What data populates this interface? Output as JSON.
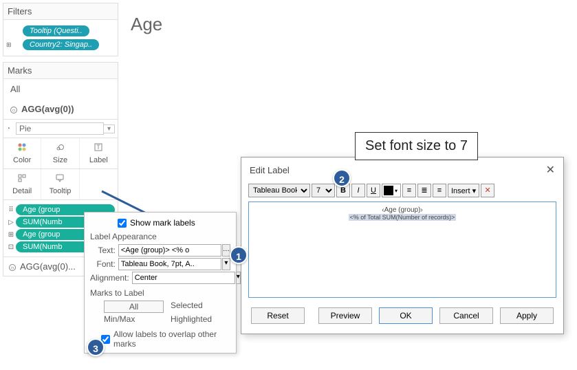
{
  "sidebar": {
    "filters_header": "Filters",
    "filter_pills": [
      {
        "label": "Tooltip (Questi..",
        "has_close": true
      },
      {
        "label": "Country2: Singap..",
        "has_close": false,
        "indicator": "⊞"
      }
    ],
    "marks_header": "Marks",
    "marks_tabs": [
      {
        "label": "All",
        "selected": false
      },
      {
        "label": "AGG(avg(0))",
        "selected": true,
        "icon": "○"
      }
    ],
    "mark_type": "Pie",
    "shelves_top": [
      {
        "label": "Color",
        "icon": "color"
      },
      {
        "label": "Size",
        "icon": "size"
      },
      {
        "label": "Label",
        "icon": "label"
      }
    ],
    "shelves_bottom": [
      {
        "label": "Detail",
        "icon": "detail"
      },
      {
        "label": "Tooltip",
        "icon": "tooltip"
      },
      {
        "label": "",
        "icon": ""
      }
    ],
    "mark_pills": [
      {
        "icon": "⠿",
        "label": "Age (group"
      },
      {
        "icon": "▷",
        "label": "SUM(Numb"
      },
      {
        "icon": "⊞",
        "label": "Age (group"
      },
      {
        "icon": "⊡",
        "label": "SUM(Numb"
      }
    ],
    "agg_row": "AGG(avg(0)..."
  },
  "canvas": {
    "title": "Age"
  },
  "label_popup": {
    "show_mark_labels": "Show mark labels",
    "show_mark_labels_checked": true,
    "appearance_header": "Label Appearance",
    "text_label": "Text:",
    "text_value": "<Age (group)> <% o",
    "font_label": "Font:",
    "font_value": "Tableau Book, 7pt, A..",
    "alignment_label": "Alignment:",
    "alignment_value": "Center",
    "marks_to_label_header": "Marks to Label",
    "mtl_options": [
      "All",
      "Selected",
      "Min/Max",
      "Highlighted"
    ],
    "overlap_label": "Allow labels to overlap other marks",
    "overlap_checked": true
  },
  "dialog": {
    "title": "Edit Label",
    "font_name": "Tableau Book",
    "font_size": "7",
    "insert_label": "Insert ▾",
    "editor_line1": "‹Age (group)›",
    "editor_line2": "<% of Total SUM(Number of records)>",
    "buttons": {
      "reset": "Reset",
      "preview": "Preview",
      "ok": "OK",
      "cancel": "Cancel",
      "apply": "Apply"
    }
  },
  "callouts": {
    "n1": "1",
    "n2": "2",
    "n3": "3",
    "callout_text": "Set font size to 7"
  }
}
